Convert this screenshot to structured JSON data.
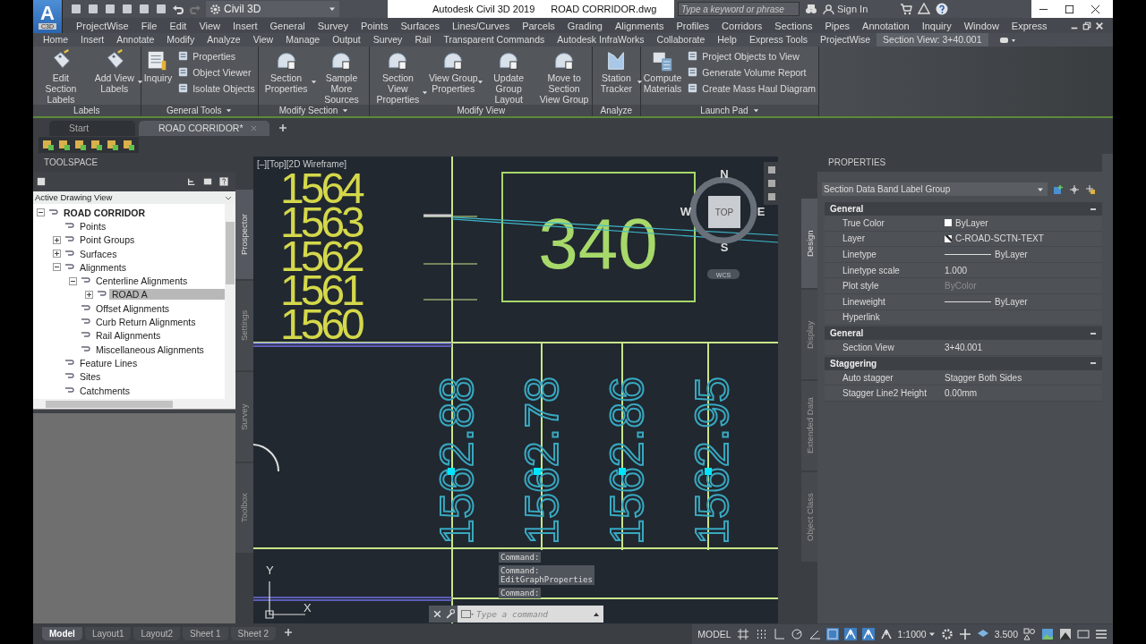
{
  "app_logo": {
    "letter": "A",
    "caption": "C3D"
  },
  "workspace": {
    "value": "Civil 3D"
  },
  "window": {
    "app_title": "Autodesk Civil 3D 2019",
    "file_title": "ROAD CORRIDOR.dwg"
  },
  "search": {
    "placeholder": "Type a keyword or phrase"
  },
  "sign_in": {
    "label": "Sign In"
  },
  "menu": [
    "ProjectWise",
    "File",
    "Edit",
    "View",
    "Insert",
    "General",
    "Survey",
    "Points",
    "Surfaces",
    "Lines/Curves",
    "Parcels",
    "Grading",
    "Alignments",
    "Profiles",
    "Corridors",
    "Sections",
    "Pipes",
    "Annotation",
    "Inquiry",
    "Window",
    "Express"
  ],
  "ribbon_tabs": [
    {
      "label": "Home",
      "selected": false
    },
    {
      "label": "Insert",
      "selected": false
    },
    {
      "label": "Annotate",
      "selected": false
    },
    {
      "label": "Modify",
      "selected": false
    },
    {
      "label": "Analyze",
      "selected": false
    },
    {
      "label": "View",
      "selected": false
    },
    {
      "label": "Manage",
      "selected": false
    },
    {
      "label": "Output",
      "selected": false
    },
    {
      "label": "Survey",
      "selected": false
    },
    {
      "label": "Rail",
      "selected": false
    },
    {
      "label": "Transparent Commands",
      "selected": false
    },
    {
      "label": "Autodesk InfraWorks",
      "selected": false
    },
    {
      "label": "Collaborate",
      "selected": false
    },
    {
      "label": "Help",
      "selected": false
    },
    {
      "label": "Express Tools",
      "selected": false
    },
    {
      "label": "ProjectWise",
      "selected": false
    },
    {
      "label": "Section View: 3+40.001",
      "selected": true
    }
  ],
  "ribbon_panels": [
    {
      "title": "Labels",
      "menu": false,
      "big": [
        {
          "label": "Edit Section Labels",
          "dropdown": false
        },
        {
          "label": "Add View Labels",
          "dropdown": true
        }
      ]
    },
    {
      "title": "General Tools",
      "menu": true,
      "big": [
        {
          "label": "Inquiry",
          "dropdown": false
        }
      ],
      "small": [
        "Properties",
        "Object Viewer",
        "Isolate Objects"
      ]
    },
    {
      "title": "Modify Section",
      "menu": true,
      "big": [
        {
          "label": "Section Properties",
          "dropdown": true
        },
        {
          "label": "Sample More Sources",
          "dropdown": false
        }
      ]
    },
    {
      "title": "Modify View",
      "menu": false,
      "big": [
        {
          "label": "Section View Properties",
          "dropdown": true
        },
        {
          "label": "View Group Properties",
          "dropdown": true
        },
        {
          "label": "Update Group Layout",
          "dropdown": false
        },
        {
          "label": "Move to Section View Group",
          "dropdown": false
        }
      ]
    },
    {
      "title": "Analyze",
      "menu": false,
      "big": [
        {
          "label": "Station Tracker",
          "dropdown": true
        }
      ]
    },
    {
      "title": "Launch Pad",
      "menu": true,
      "big": [
        {
          "label": "Compute Materials",
          "dropdown": false
        }
      ],
      "small": [
        "Project Objects to View",
        "Generate Volume Report",
        "Create Mass Haul Diagram"
      ]
    }
  ],
  "doc_tabs": [
    {
      "label": "Start",
      "selected": false
    },
    {
      "label": "ROAD CORRIDOR*",
      "selected": true
    }
  ],
  "toolspace": {
    "title": "TOOLSPACE",
    "view": "Active Drawing View",
    "tree": [
      {
        "label": "ROAD CORRIDOR",
        "expanded": true,
        "children": [
          {
            "label": "Points"
          },
          {
            "label": "Point Groups",
            "expanded": false
          },
          {
            "label": "Surfaces",
            "expanded": false
          },
          {
            "label": "Alignments",
            "expanded": true,
            "children": [
              {
                "label": "Centerline Alignments",
                "expanded": true,
                "children": [
                  {
                    "label": "ROAD A",
                    "expanded": false,
                    "selected": true
                  }
                ]
              },
              {
                "label": "Offset Alignments"
              },
              {
                "label": "Curb Return Alignments"
              },
              {
                "label": "Rail Alignments"
              },
              {
                "label": "Miscellaneous Alignments"
              }
            ]
          },
          {
            "label": "Feature Lines"
          },
          {
            "label": "Sites"
          },
          {
            "label": "Catchments"
          }
        ]
      }
    ],
    "side_tabs": [
      {
        "label": "Prospector",
        "selected": true
      },
      {
        "label": "Settings",
        "selected": false
      },
      {
        "label": "Survey",
        "selected": false
      },
      {
        "label": "Toolbox",
        "selected": false
      }
    ]
  },
  "viewport": {
    "label": "[–][Top][2D Wireframe]",
    "elevations": [
      "1564",
      "1563",
      "1562",
      "1561",
      "1560"
    ],
    "station_box": "340",
    "band_values": [
      "1562.88",
      "1562.78",
      "1562.86",
      "1562.95"
    ],
    "viewcube": {
      "north": "N",
      "south": "S",
      "east": "E",
      "west": "W",
      "face": "TOP",
      "ucs": "WCS"
    },
    "axes": {
      "x": "X",
      "y": "Y"
    },
    "history": [
      "Command:",
      "Command:\nEditGraphProperties",
      "Command:"
    ],
    "command": {
      "placeholder": "Type a command"
    }
  },
  "properties": {
    "title": "PROPERTIES",
    "object": "Section Data Band Label Group",
    "sections": [
      {
        "title": "General",
        "expanded": true,
        "rows": [
          {
            "label": "True Color",
            "value": "ByLayer",
            "kind": "swatch"
          },
          {
            "label": "Layer",
            "value": "C-ROAD-SCTN-TEXT",
            "kind": "layer"
          },
          {
            "label": "Linetype",
            "value": "ByLayer",
            "kind": "line"
          },
          {
            "label": "Linetype scale",
            "value": "1.000",
            "kind": "text"
          },
          {
            "label": "Plot style",
            "value": "ByColor",
            "kind": "greyed"
          },
          {
            "label": "Lineweight",
            "value": "ByLayer",
            "kind": "line"
          },
          {
            "label": "Hyperlink",
            "kind": "text"
          }
        ]
      },
      {
        "title": "General",
        "expanded": true,
        "rows": [
          {
            "label": "Section View",
            "value": "3+40.001",
            "kind": "text"
          }
        ]
      },
      {
        "title": "Staggering",
        "expanded": true,
        "rows": [
          {
            "label": "Auto stagger",
            "value": "Stagger Both Sides",
            "kind": "text"
          },
          {
            "label": "Stagger Line2 Height",
            "value": "0.00mm",
            "kind": "text"
          }
        ]
      }
    ],
    "side_tabs": [
      {
        "label": "Design",
        "selected": true
      },
      {
        "label": "Display",
        "selected": false
      },
      {
        "label": "Extended Data",
        "selected": false
      },
      {
        "label": "Object Class",
        "selected": false
      }
    ]
  },
  "layout_tabs": [
    {
      "label": "Model",
      "selected": true
    },
    {
      "label": "Layout1",
      "selected": false
    },
    {
      "label": "Layout2",
      "selected": false
    },
    {
      "label": "Sheet 1",
      "selected": false
    },
    {
      "label": "Sheet 2",
      "selected": false
    }
  ],
  "status_bar": {
    "space": "MODEL",
    "scale": "1:1000",
    "lineweight": "3.500"
  }
}
